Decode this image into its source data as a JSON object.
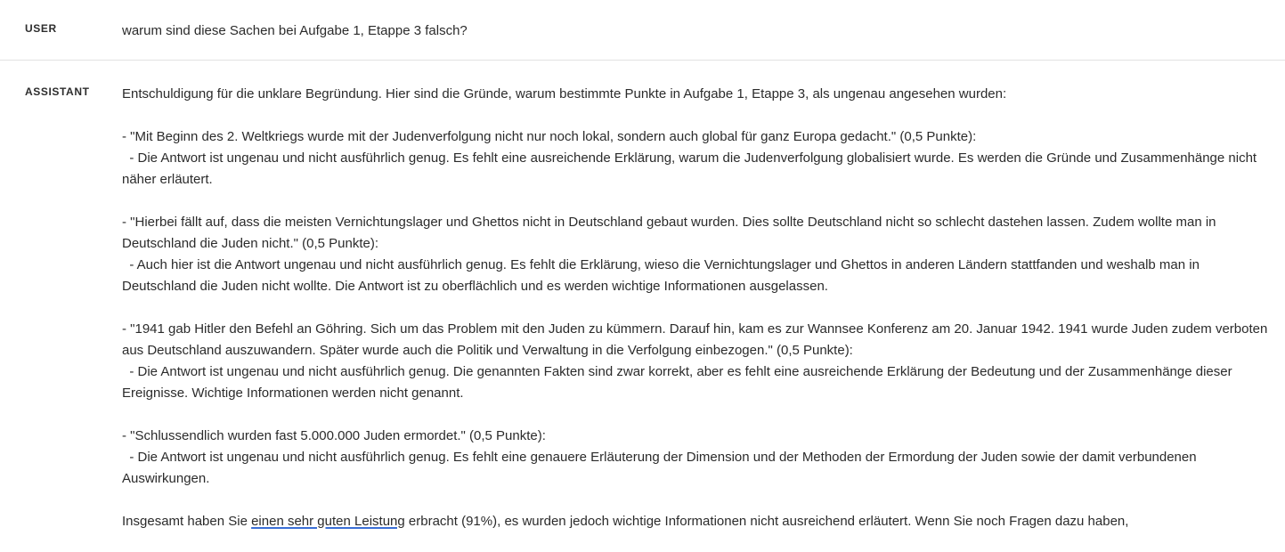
{
  "user": {
    "role_label": "USER",
    "message": "warum sind diese Sachen bei Aufgabe 1, Etappe 3 falsch?"
  },
  "assistant": {
    "role_label": "ASSISTANT",
    "intro": "Entschuldigung für die unklare Begründung. Hier sind die Gründe, warum bestimmte Punkte in Aufgabe 1, Etappe 3, als ungenau angesehen wurden:",
    "items": [
      {
        "quote": "- \"Mit Beginn des 2. Weltkriegs wurde mit der Judenverfolgung nicht nur noch lokal, sondern auch global für ganz Europa gedacht.\" (0,5 Punkte):",
        "explanation": "  - Die Antwort ist ungenau und nicht ausführlich genug. Es fehlt eine ausreichende Erklärung, warum die Judenverfolgung globalisiert wurde. Es werden die Gründe und Zusammenhänge nicht näher erläutert."
      },
      {
        "quote": "- \"Hierbei fällt auf, dass die meisten Vernichtungslager und Ghettos nicht in Deutschland gebaut wurden. Dies sollte Deutschland nicht so schlecht dastehen lassen. Zudem wollte man in Deutschland die Juden nicht.\" (0,5 Punkte):",
        "explanation": "  - Auch hier ist die Antwort ungenau und nicht ausführlich genug. Es fehlt die Erklärung, wieso die Vernichtungslager und Ghettos in anderen Ländern stattfanden und weshalb man in Deutschland die Juden nicht wollte. Die Antwort ist zu oberflächlich und es werden wichtige Informationen ausgelassen."
      },
      {
        "quote": "- \"1941 gab Hitler den Befehl an Göhring. Sich um das Problem mit den Juden zu kümmern. Darauf hin, kam es zur Wannsee Konferenz am 20. Januar 1942. 1941 wurde Juden zudem verboten aus Deutschland auszuwandern. Später wurde auch die Politik und Verwaltung in die Verfolgung einbezogen.\" (0,5 Punkte):",
        "explanation": "  - Die Antwort ist ungenau und nicht ausführlich genug. Die genannten Fakten sind zwar korrekt, aber es fehlt eine ausreichende Erklärung der Bedeutung und der Zusammenhänge dieser Ereignisse. Wichtige Informationen werden nicht genannt."
      },
      {
        "quote": "- \"Schlussendlich wurden fast 5.000.000 Juden ermordet.\" (0,5 Punkte):",
        "explanation": "  - Die Antwort ist ungenau und nicht ausführlich genug. Es fehlt eine genauere Erläuterung der Dimension und der Methoden der Ermordung der Juden sowie der damit verbundenen Auswirkungen."
      }
    ],
    "conclusion": {
      "before": "Insgesamt haben Sie ",
      "link_text": "einen sehr guten Leistung",
      "after": " erbracht (91%), es wurden jedoch wichtige Informationen nicht ausreichend erläutert. Wenn Sie noch Fragen dazu haben,"
    }
  }
}
